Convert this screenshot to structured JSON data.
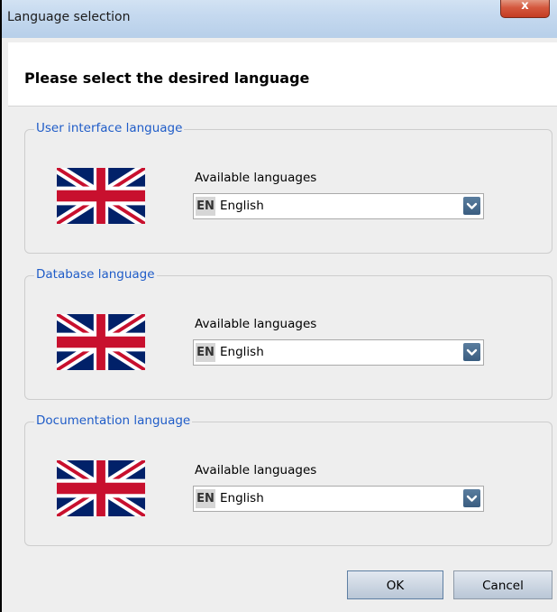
{
  "window": {
    "title": "Language selection",
    "close_label": "x"
  },
  "header": {
    "text": "Please select the desired language"
  },
  "groups": [
    {
      "legend": "User interface language",
      "flag_icon": "uk-flag-icon",
      "available_label": "Available languages",
      "selected": {
        "code": "EN",
        "name": "English"
      }
    },
    {
      "legend": "Database language",
      "flag_icon": "uk-flag-icon",
      "available_label": "Available languages",
      "selected": {
        "code": "EN",
        "name": "English"
      }
    },
    {
      "legend": "Documentation language",
      "flag_icon": "uk-flag-icon",
      "available_label": "Available languages",
      "selected": {
        "code": "EN",
        "name": "English"
      }
    }
  ],
  "buttons": {
    "ok": "OK",
    "cancel": "Cancel"
  },
  "colors": {
    "legend_text": "#1f5cc8",
    "flag_blue": "#012169",
    "flag_red": "#c8102e"
  }
}
